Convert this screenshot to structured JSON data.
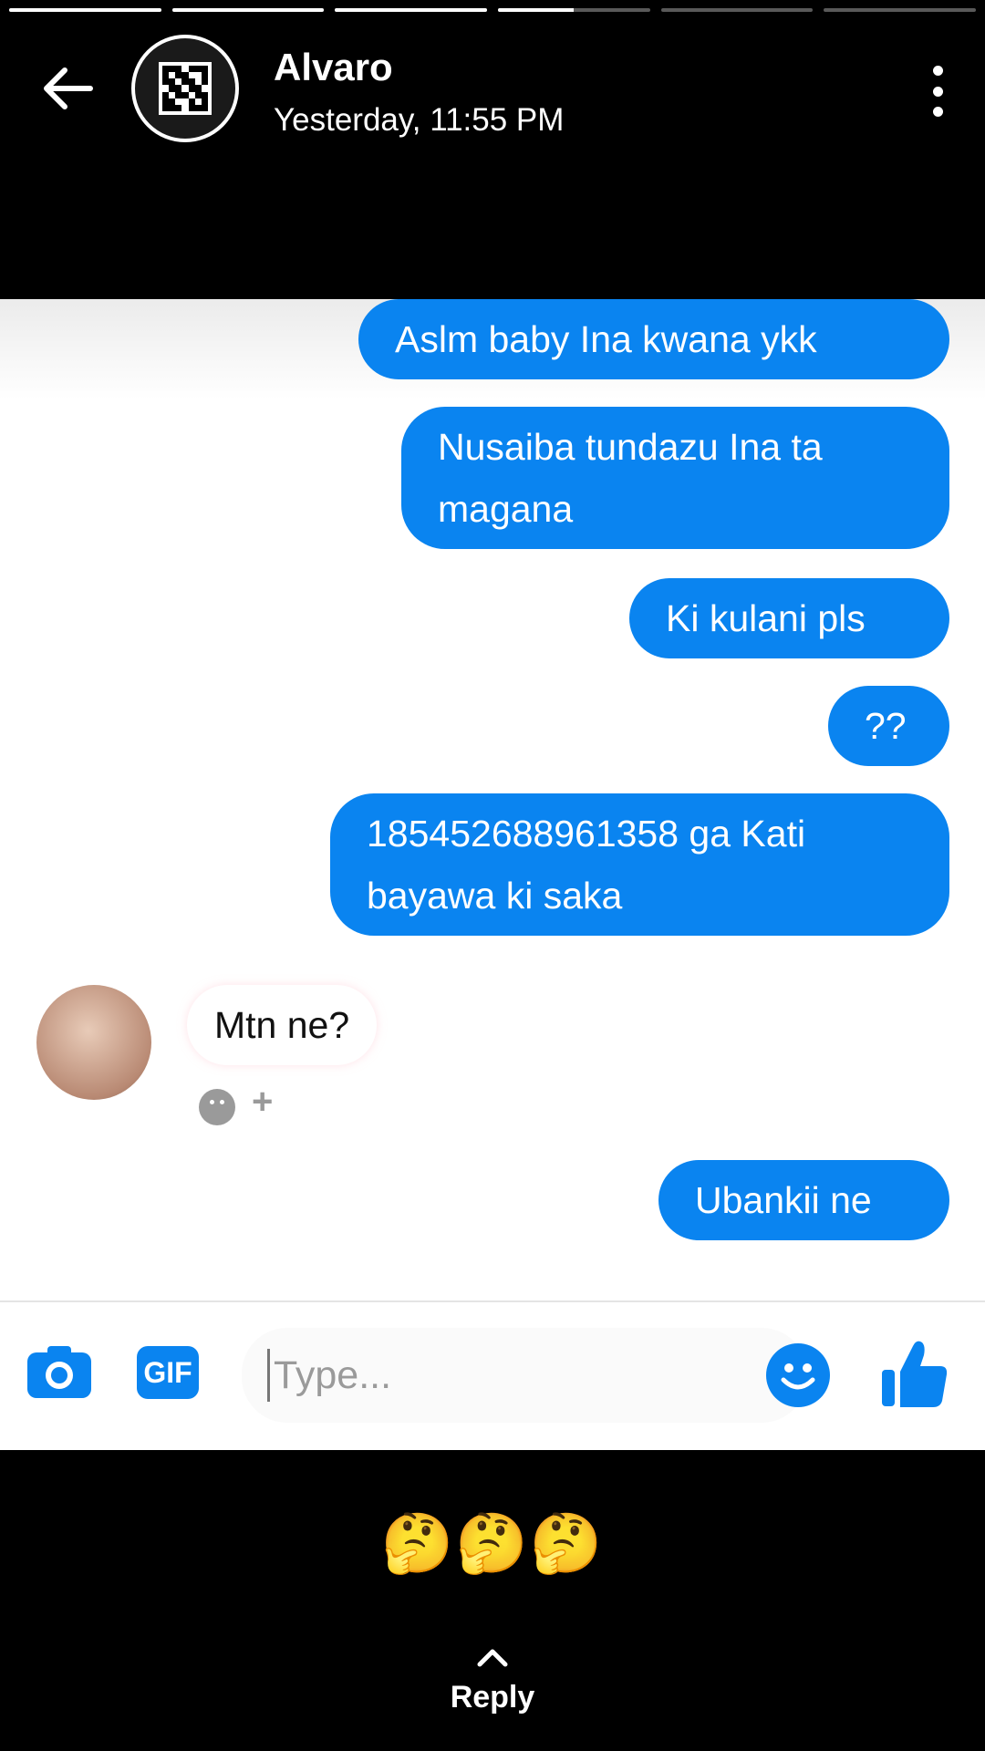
{
  "story": {
    "progress": [
      1,
      1,
      1,
      0.5,
      0,
      0
    ],
    "author_name": "Alvaro",
    "timestamp": "Yesterday, 11:55 PM",
    "reaction_caption": "🤔🤔🤔",
    "reply_label": "Reply"
  },
  "chat": {
    "messages": [
      {
        "direction": "outgoing",
        "text": "Aslm baby Ina kwana ykk"
      },
      {
        "direction": "outgoing",
        "text": "Nusaiba tundazu Ina ta magana"
      },
      {
        "direction": "outgoing",
        "text": "Ki kulani pls"
      },
      {
        "direction": "outgoing",
        "text": "??"
      },
      {
        "direction": "outgoing",
        "text": "185452688961358 ga Kati bayawa ki saka"
      },
      {
        "direction": "incoming",
        "text": "Mtn ne?"
      },
      {
        "direction": "outgoing",
        "text": "Ubankii ne"
      }
    ],
    "reaction_add": "+",
    "composer": {
      "placeholder": "Type...",
      "gif_label": "GIF"
    }
  },
  "colors": {
    "messenger_blue": "#0a84f0",
    "background_dark": "#000000"
  }
}
